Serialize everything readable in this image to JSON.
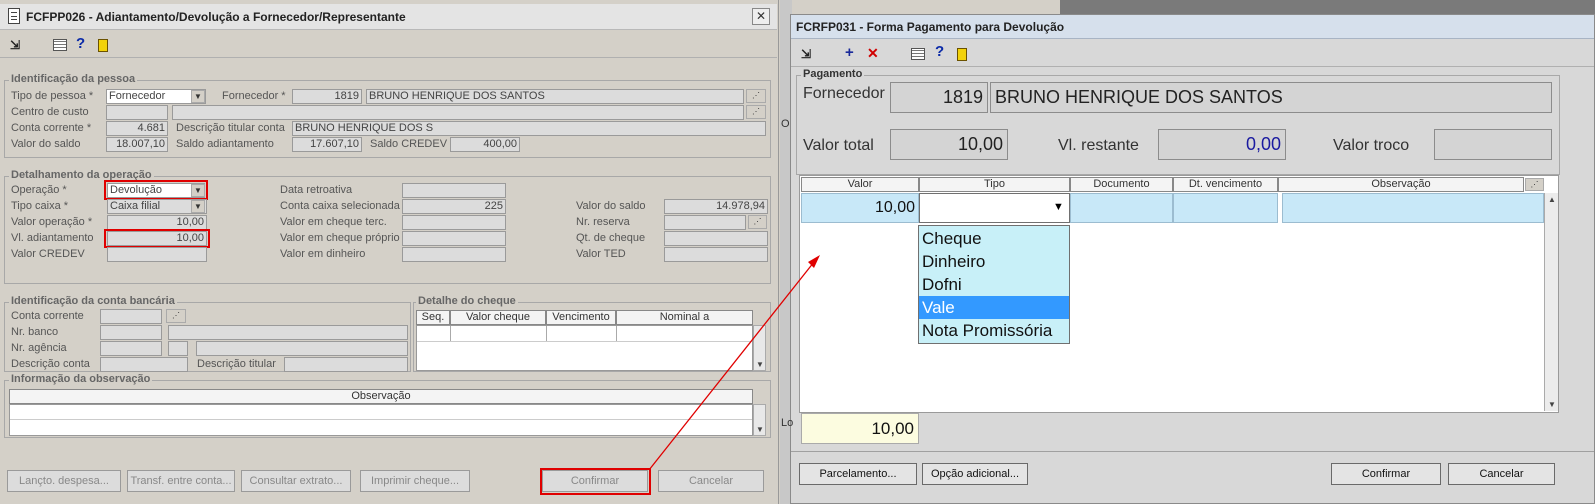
{
  "left_window": {
    "title": "FCFPP026 - Adiantamento/Devolução a Fornecedor/Representante",
    "close": "✕",
    "identificacao": {
      "title": "Identificação da pessoa",
      "tipo_pessoa_label": "Tipo de pessoa *",
      "tipo_pessoa_value": "Fornecedor",
      "fornecedor_label": "Fornecedor *",
      "fornecedor_code": "1819",
      "fornecedor_name": "BRUNO HENRIQUE DOS SANTOS",
      "centro_custo_label": "Centro de custo",
      "conta_corrente_label": "Conta corrente *",
      "conta_corrente_value": "4.681",
      "descricao_titular_label": "Descrição titular conta",
      "descricao_titular_value": "BRUNO HENRIQUE DOS S",
      "valor_saldo_label": "Valor do saldo",
      "valor_saldo_value": "18.007,10",
      "saldo_adiantamento_label": "Saldo adiantamento",
      "saldo_adiantamento_value": "17.607,10",
      "saldo_credev_label": "Saldo CREDEV",
      "saldo_credev_value": "400,00"
    },
    "detalhamento": {
      "title": "Detalhamento da operação",
      "operacao_label": "Operação *",
      "operacao_value": "Devolução",
      "tipo_caixa_label": "Tipo caixa *",
      "tipo_caixa_value": "Caixa filial",
      "valor_operacao_label": "Valor operação *",
      "valor_operacao_value": "10,00",
      "vl_adiantamento_label": "Vl. adiantamento",
      "vl_adiantamento_value": "10,00",
      "valor_credev_label": "Valor CREDEV",
      "data_retroativa_label": "Data retroativa",
      "conta_caixa_label": "Conta caixa selecionada",
      "conta_caixa_value": "225",
      "cheque_terc_label": "Valor em cheque terc.",
      "cheque_proprio_label": "Valor em cheque próprio",
      "dinheiro_label": "Valor em dinheiro",
      "valor_do_saldo_label": "Valor do saldo",
      "valor_do_saldo_value": "14.978,94",
      "nr_reserva_label": "Nr. reserva",
      "qt_cheque_label": "Qt. de cheque",
      "valor_ted_label": "Valor TED"
    },
    "conta_bancaria": {
      "title": "Identificação da conta bancária",
      "conta_corrente_label": "Conta corrente",
      "nr_banco_label": "Nr. banco",
      "nr_agencia_label": "Nr. agência",
      "descricao_conta_label": "Descrição conta",
      "descricao_titular_label": "Descrição titular"
    },
    "cheque": {
      "title": "Detalhe do cheque",
      "columns": [
        "Seq.",
        "Valor cheque",
        "Vencimento",
        "Nominal a"
      ]
    },
    "observacao": {
      "title": "Informação da observação",
      "column": "Observação"
    },
    "buttons": {
      "lancto": "Lançto. despesa...",
      "transf": "Transf. entre conta...",
      "consultar": "Consultar extrato...",
      "imprimir": "Imprimir cheque...",
      "confirmar": "Confirmar",
      "cancelar": "Cancelar"
    }
  },
  "right_window": {
    "title": "FCRFP031 - Forma Pagamento para Devolução",
    "pagamento_title": "Pagamento",
    "fornecedor_label": "Fornecedor",
    "fornecedor_code": "1819",
    "fornecedor_name": "BRUNO HENRIQUE DOS SANTOS",
    "valor_total_label": "Valor total",
    "valor_total_value": "10,00",
    "vl_restante_label": "Vl. restante",
    "vl_restante_value": "0,00",
    "valor_troco_label": "Valor troco",
    "grid_columns": [
      "Valor",
      "Tipo",
      "Documento",
      "Dt. vencimento",
      "Observação"
    ],
    "row_valor": "10,00",
    "tipo_options": [
      "Cheque",
      "Dinheiro",
      "Dofni",
      "Vale",
      "Nota Promissória"
    ],
    "selected_option": "Vale",
    "total_value": "10,00",
    "behind_text": "Lo",
    "behind_text_2": "O",
    "buttons": {
      "parcelamento": "Parcelamento...",
      "opcao_adicional": "Opção adicional...",
      "confirmar": "Confirmar",
      "cancelar": "Cancelar"
    }
  },
  "colors": {
    "accent_red": "#e00000",
    "title_bar": "#d6e0ec",
    "selection": "#3399ff",
    "grid_cell": "#c8e8f8",
    "restante_value": "#1a1aa0"
  }
}
